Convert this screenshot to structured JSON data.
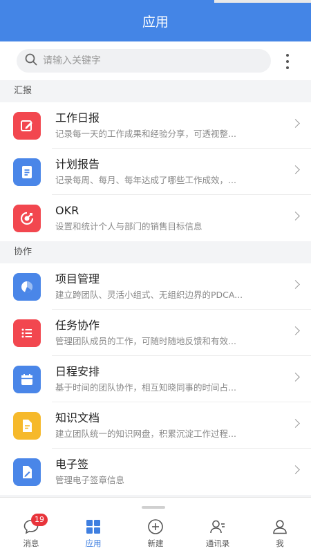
{
  "header": {
    "title": "应用"
  },
  "search": {
    "placeholder": "请输入关键字"
  },
  "sections": [
    {
      "title": "汇报",
      "items": [
        {
          "title": "工作日报",
          "desc": "记录每一天的工作成果和经验分享，可透视整...",
          "icon": "edit-icon",
          "color": "#f2474f"
        },
        {
          "title": "计划报告",
          "desc": "记录每周、每月、每年达成了哪些工作成效，...",
          "icon": "document-icon",
          "color": "#4a86e8"
        },
        {
          "title": "OKR",
          "desc": "设置和统计个人与部门的销售目标信息",
          "icon": "target-icon",
          "color": "#f2474f"
        }
      ]
    },
    {
      "title": "协作",
      "items": [
        {
          "title": "项目管理",
          "desc": "建立跨团队、灵活小组式、无组织边界的PDCA...",
          "icon": "pie-chart-icon",
          "color": "#4a86e8"
        },
        {
          "title": "任务协作",
          "desc": "管理团队成员的工作，可随时随地反馈和有效...",
          "icon": "task-list-icon",
          "color": "#f2474f"
        },
        {
          "title": "日程安排",
          "desc": "基于时间的团队协作，相互知晓同事的时间占...",
          "icon": "calendar-icon",
          "color": "#4a86e8"
        },
        {
          "title": "知识文档",
          "desc": "建立团队统一的知识网盘，积累沉淀工作过程...",
          "icon": "file-icon",
          "color": "#f6b92b"
        },
        {
          "title": "电子签",
          "desc": "管理电子签章信息",
          "icon": "signature-icon",
          "color": "#4a86e8"
        }
      ]
    }
  ],
  "nav": {
    "items": [
      {
        "label": "消息",
        "icon": "chat-icon",
        "badge": "19"
      },
      {
        "label": "应用",
        "icon": "apps-grid-icon",
        "active": true
      },
      {
        "label": "新建",
        "icon": "add-circle-icon"
      },
      {
        "label": "通讯录",
        "icon": "contacts-icon"
      },
      {
        "label": "我",
        "icon": "user-icon"
      }
    ],
    "active_color": "#3f7fe0"
  }
}
